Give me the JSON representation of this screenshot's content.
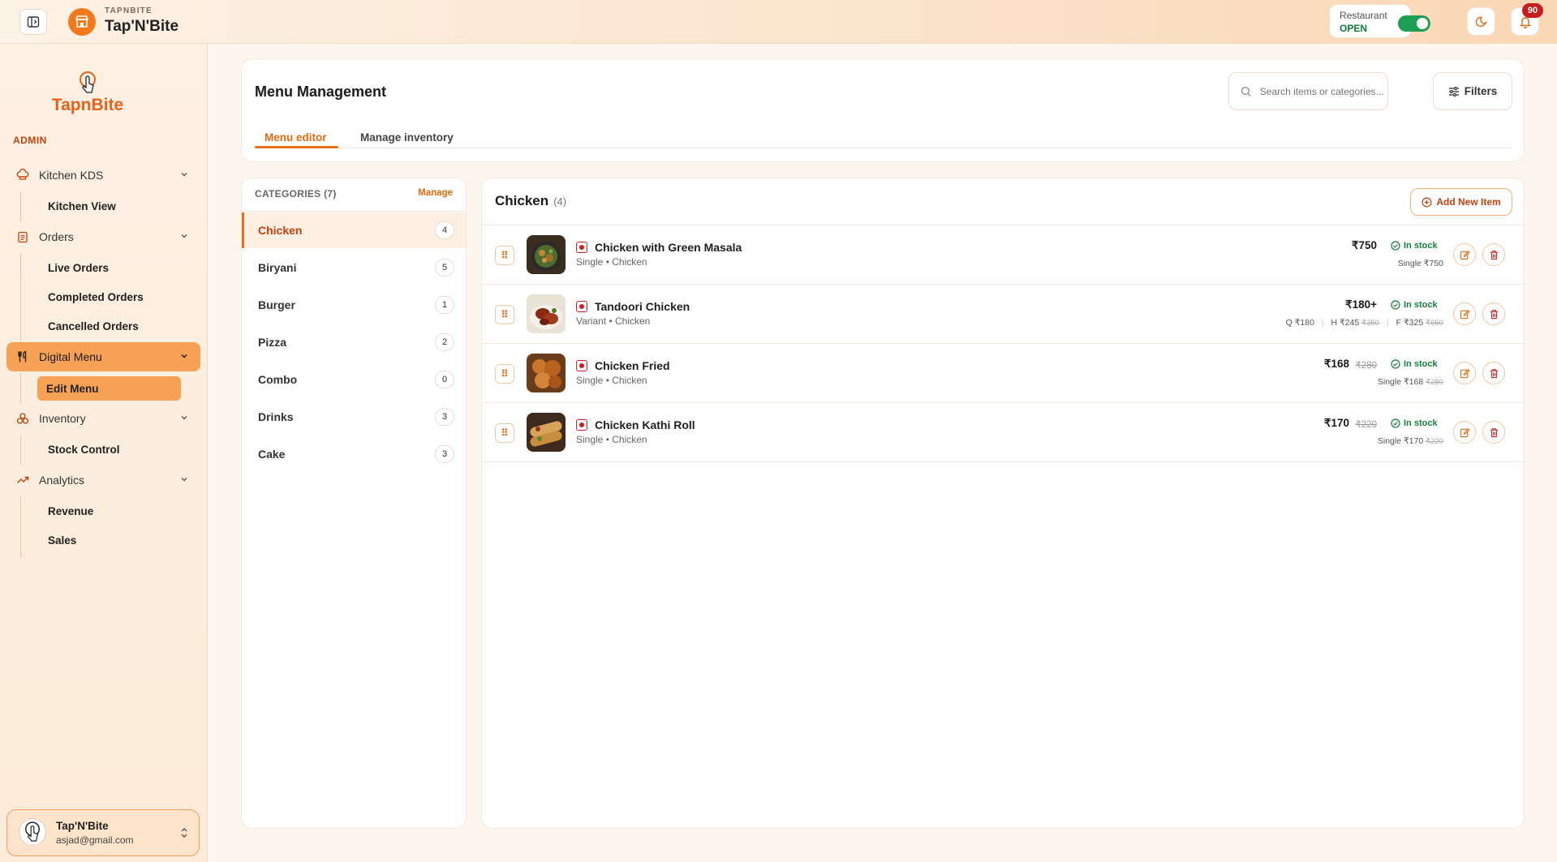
{
  "topbar": {
    "eyebrow": "TAPNBITE",
    "brand": "Tap'N'Bite",
    "restaurant_label": "Restaurant",
    "restaurant_status": "OPEN",
    "notification_count": "90"
  },
  "sidebar": {
    "logo_text": "TapnBite",
    "section_label": "ADMIN",
    "nav": [
      {
        "label": "Kitchen KDS",
        "icon": "chef-hat-icon",
        "subs": [
          "Kitchen View"
        ]
      },
      {
        "label": "Orders",
        "icon": "clipboard-icon",
        "subs": [
          "Live Orders",
          "Completed Orders",
          "Cancelled Orders"
        ]
      },
      {
        "label": "Digital Menu",
        "icon": "utensils-icon",
        "subs": [
          "Edit Menu"
        ],
        "active": true
      },
      {
        "label": "Inventory",
        "icon": "boxes-icon",
        "subs": [
          "Stock Control"
        ]
      },
      {
        "label": "Analytics",
        "icon": "trend-icon",
        "subs": [
          "Revenue",
          "Sales"
        ]
      }
    ],
    "user": {
      "name": "Tap'N'Bite",
      "email": "asjad@gmail.com"
    }
  },
  "header": {
    "title": "Menu Management",
    "search_placeholder": "Search items or categories...",
    "filters_label": "Filters",
    "tabs": [
      {
        "label": "Menu editor",
        "active": true
      },
      {
        "label": "Manage inventory",
        "active": false
      }
    ]
  },
  "categories": {
    "heading": "CATEGORIES (7)",
    "manage_label": "Manage",
    "items": [
      {
        "name": "Chicken",
        "count": "4",
        "active": true
      },
      {
        "name": "Biryani",
        "count": "5"
      },
      {
        "name": "Burger",
        "count": "1"
      },
      {
        "name": "Pizza",
        "count": "2"
      },
      {
        "name": "Combo",
        "count": "0"
      },
      {
        "name": "Drinks",
        "count": "3"
      },
      {
        "name": "Cake",
        "count": "3"
      }
    ]
  },
  "items_panel": {
    "title": "Chicken",
    "count": "(4)",
    "add_label": "Add New Item",
    "items": [
      {
        "name": "Chicken with Green Masala",
        "meta": "Single • Chicken",
        "price": "₹750",
        "old_price": "",
        "stock": "In stock",
        "sub": "Single ₹750",
        "sub_old": ""
      },
      {
        "name": "Tandoori Chicken",
        "meta": "Variant • Chicken",
        "price": "₹180+",
        "old_price": "",
        "stock": "In stock",
        "variants": [
          {
            "text": "Q ₹180",
            "old": ""
          },
          {
            "text": "H ₹245",
            "old": "₹350"
          },
          {
            "text": "F ₹325",
            "old": "₹650"
          }
        ]
      },
      {
        "name": "Chicken Fried",
        "meta": "Single • Chicken",
        "price": "₹168",
        "old_price": "₹280",
        "stock": "In stock",
        "sub": "Single ₹168",
        "sub_old": "₹280"
      },
      {
        "name": "Chicken Kathi Roll",
        "meta": "Single • Chicken",
        "price": "₹170",
        "old_price": "₹220",
        "stock": "In stock",
        "sub": "Single ₹170",
        "sub_old": "₹220"
      }
    ]
  },
  "colors": {
    "accent": "#e8711b",
    "active_nav": "#f7a154",
    "in_stock": "#15803d",
    "danger": "#d11d1d"
  }
}
